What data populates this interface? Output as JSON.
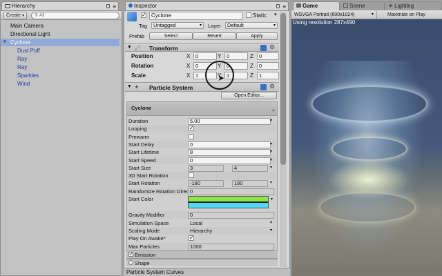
{
  "hierarchy": {
    "tab": "Hierarchy",
    "create_label": "Create",
    "search_placeholder": "All",
    "items": [
      {
        "label": "Main Camera",
        "indent": 0,
        "selected": false,
        "prefab": false
      },
      {
        "label": "Directional Light",
        "indent": 0,
        "selected": false,
        "prefab": false
      },
      {
        "label": "Cyclone",
        "indent": 0,
        "selected": true,
        "prefab": true
      },
      {
        "label": "Dust Puff",
        "indent": 1,
        "selected": false,
        "prefab": true
      },
      {
        "label": "Ray",
        "indent": 1,
        "selected": false,
        "prefab": true
      },
      {
        "label": "Ray",
        "indent": 1,
        "selected": false,
        "prefab": true
      },
      {
        "label": "Sparkles",
        "indent": 1,
        "selected": false,
        "prefab": true
      },
      {
        "label": "Wind",
        "indent": 1,
        "selected": false,
        "prefab": true
      }
    ]
  },
  "inspector": {
    "tab": "Inspector",
    "object_name": "Cyclone",
    "active": true,
    "static_label": "Static",
    "tag_label": "Tag",
    "tag_value": "Untagged",
    "layer_label": "Layer",
    "layer_value": "Default",
    "prefab_label": "Prefab",
    "prefab_buttons": [
      "Select",
      "Revert",
      "Apply"
    ],
    "transform": {
      "title": "Transform",
      "rows": [
        {
          "label": "Position",
          "x": "0",
          "y": "0",
          "z": "0"
        },
        {
          "label": "Rotation",
          "x": "0",
          "y": "0",
          "z": "0"
        },
        {
          "label": "Scale",
          "x": "1",
          "y": "1",
          "z": "1"
        }
      ]
    },
    "particle_system": {
      "title": "Particle System",
      "open_editor": "Open Editor...",
      "system_name": "Cyclone",
      "rows": [
        {
          "label": "Duration",
          "value": "5.00",
          "type": "field"
        },
        {
          "label": "Looping",
          "value": true,
          "type": "check"
        },
        {
          "label": "Prewarm",
          "value": false,
          "type": "check"
        },
        {
          "label": "Start Delay",
          "value": "0",
          "type": "field"
        },
        {
          "label": "Start Lifetime",
          "value": "8",
          "type": "field"
        },
        {
          "label": "Start Speed",
          "value": "0",
          "type": "field"
        },
        {
          "label": "Start Size",
          "value": "3",
          "value2": "4",
          "type": "range"
        },
        {
          "label": "3D Start Rotation",
          "value": false,
          "type": "check"
        },
        {
          "label": "Start Rotation",
          "value": "-180",
          "value2": "180",
          "type": "range"
        },
        {
          "label": "Randomize Rotation Direc",
          "value": "0",
          "type": "plain"
        },
        {
          "label": "Start Color",
          "value": "",
          "type": "color"
        },
        {
          "label": "Gravity Modifier",
          "value": "0",
          "type": "plain"
        },
        {
          "label": "Simulation Space",
          "value": "Local",
          "type": "dropdown"
        },
        {
          "label": "Scaling Mode",
          "value": "Hierarchy",
          "type": "dropdown"
        },
        {
          "label": "Play On Awake*",
          "value": true,
          "type": "check"
        },
        {
          "label": "Max Particles",
          "value": "1000",
          "type": "plain"
        }
      ],
      "modules": [
        "Emission",
        "Shape"
      ]
    },
    "curves_title": "Particle System Curves"
  },
  "game": {
    "tabs": [
      "Game",
      "Scene",
      "Lighting"
    ],
    "resolution_dropdown": "WSVGA Portrait (600x1024)",
    "maximize_label": "Maximize on Play",
    "overlay_text": "Using resolution 287x490"
  },
  "colors": {
    "selection": "#8fa9d8",
    "prefab_text": "#1a3fae",
    "gradient_top": "#8fe64a",
    "gradient_bottom": "#4fd9f2"
  }
}
